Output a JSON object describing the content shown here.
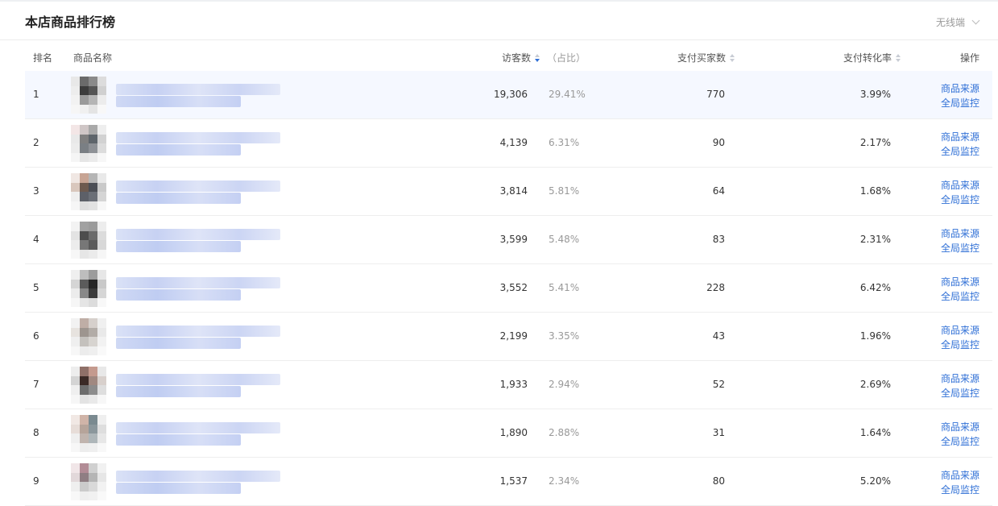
{
  "header": {
    "title": "本店商品排行榜",
    "device_select": "无线端"
  },
  "table": {
    "columns": {
      "rank": "排名",
      "name": "商品名称",
      "visitors": "访客数",
      "share": "（占比）",
      "buyers": "支付买家数",
      "conversion": "支付转化率",
      "actions": "操作"
    },
    "rows": [
      {
        "rank": "1",
        "visitors": "19,306",
        "share": "29.41%",
        "buyers": "770",
        "conversion": "3.99%",
        "action1": "商品来源",
        "action2": "全局监控"
      },
      {
        "rank": "2",
        "visitors": "4,139",
        "share": "6.31%",
        "buyers": "90",
        "conversion": "2.17%",
        "action1": "商品来源",
        "action2": "全局监控"
      },
      {
        "rank": "3",
        "visitors": "3,814",
        "share": "5.81%",
        "buyers": "64",
        "conversion": "1.68%",
        "action1": "商品来源",
        "action2": "全局监控"
      },
      {
        "rank": "4",
        "visitors": "3,599",
        "share": "5.48%",
        "buyers": "83",
        "conversion": "2.31%",
        "action1": "商品来源",
        "action2": "全局监控"
      },
      {
        "rank": "5",
        "visitors": "3,552",
        "share": "5.41%",
        "buyers": "228",
        "conversion": "6.42%",
        "action1": "商品来源",
        "action2": "全局监控"
      },
      {
        "rank": "6",
        "visitors": "2,199",
        "share": "3.35%",
        "buyers": "43",
        "conversion": "1.96%",
        "action1": "商品来源",
        "action2": "全局监控"
      },
      {
        "rank": "7",
        "visitors": "1,933",
        "share": "2.94%",
        "buyers": "52",
        "conversion": "2.69%",
        "action1": "商品来源",
        "action2": "全局监控"
      },
      {
        "rank": "8",
        "visitors": "1,890",
        "share": "2.88%",
        "buyers": "31",
        "conversion": "1.64%",
        "action1": "商品来源",
        "action2": "全局监控"
      },
      {
        "rank": "9",
        "visitors": "1,537",
        "share": "2.34%",
        "buyers": "80",
        "conversion": "5.20%",
        "action1": "商品来源",
        "action2": "全局监控"
      }
    ]
  },
  "colors": {
    "link": "#2f6fd6",
    "highlight_row": "#f5f8ff",
    "sort_active": "#2f6fd6"
  }
}
